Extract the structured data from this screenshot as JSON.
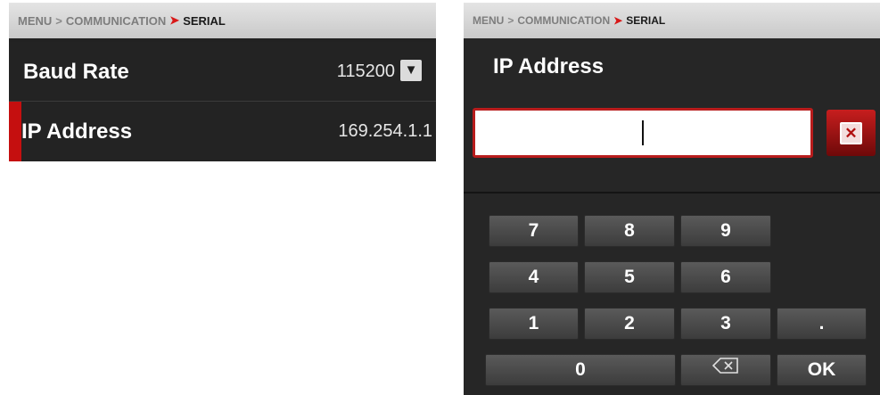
{
  "left_panel": {
    "breadcrumb": {
      "menu": "MENU",
      "section": "COMMUNICATION",
      "current": "SERIAL"
    },
    "rows": [
      {
        "label": "Baud Rate",
        "value": "115200",
        "icon": "chevron-down-icon"
      },
      {
        "label": "IP Address",
        "value": "169.254.1.1"
      }
    ]
  },
  "right_panel": {
    "breadcrumb": {
      "menu": "MENU",
      "section": "COMMUNICATION",
      "current": "SERIAL"
    },
    "title": "IP Address",
    "input_value": "",
    "clear_icon": "close-icon",
    "keys": {
      "k7": "7",
      "k8": "8",
      "k9": "9",
      "k4": "4",
      "k5": "5",
      "k6": "6",
      "k1": "1",
      "k2": "2",
      "k3": "3",
      "kdot": ".",
      "k0": "0",
      "backspace_icon": "backspace-icon",
      "ok": "OK"
    }
  },
  "colors": {
    "accent_red": "#c50f0f",
    "panel_bg": "#232323",
    "breadcrumb_bg": "#d6d6d6"
  }
}
